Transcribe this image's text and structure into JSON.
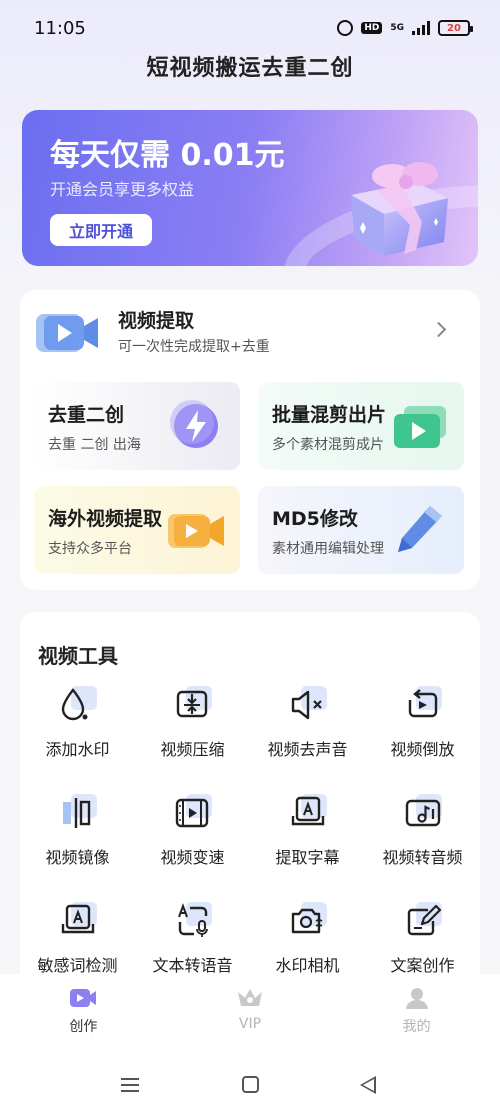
{
  "status_bar": {
    "time": "11:05",
    "network": "5G",
    "hd": "HD",
    "battery": "20"
  },
  "app_title": "短视频搬运去重二创",
  "vip_banner": {
    "headline": "每天仅需 0.01元",
    "subtitle": "开通会员享更多权益",
    "button": "立即开通"
  },
  "video_extract": {
    "title": "视频提取",
    "subtitle": "可一次性完成提取+去重"
  },
  "feature_tiles": [
    {
      "title": "去重二创",
      "subtitle": "去重 二创 出海",
      "icon": "lightning-icon"
    },
    {
      "title": "批量混剪出片",
      "subtitle": "多个素材混剪成片",
      "icon": "video-stack-icon"
    },
    {
      "title": "海外视频提取",
      "subtitle": "支持众多平台",
      "icon": "video-camera-icon"
    },
    {
      "title": "MD5修改",
      "subtitle": "素材通用编辑处理",
      "icon": "pen-icon"
    }
  ],
  "tools": {
    "title": "视频工具",
    "items": [
      {
        "label": "添加水印",
        "icon": "droplet-icon"
      },
      {
        "label": "视频压缩",
        "icon": "compress-icon"
      },
      {
        "label": "视频去声音",
        "icon": "mute-icon"
      },
      {
        "label": "视频倒放",
        "icon": "reverse-icon"
      },
      {
        "label": "视频镜像",
        "icon": "mirror-icon"
      },
      {
        "label": "视频变速",
        "icon": "film-speed-icon"
      },
      {
        "label": "提取字幕",
        "icon": "subtitle-icon"
      },
      {
        "label": "视频转音频",
        "icon": "audio-icon"
      },
      {
        "label": "敏感词检测",
        "icon": "text-check-icon"
      },
      {
        "label": "文本转语音",
        "icon": "text-to-speech-icon"
      },
      {
        "label": "水印相机",
        "icon": "camera-icon"
      },
      {
        "label": "文案创作",
        "icon": "edit-icon"
      }
    ]
  },
  "bottom_nav": [
    {
      "label": "创作",
      "icon": "create-icon",
      "active": true
    },
    {
      "label": "VIP",
      "icon": "crown-icon",
      "active": false
    },
    {
      "label": "我的",
      "icon": "profile-icon",
      "active": false
    }
  ],
  "colors": {
    "accent": "#6a6ff0",
    "vip_button_text": "#4d50d9",
    "tile_icon_purple": "#8d7ff2",
    "tool_icon_bg": "#dde6fb"
  }
}
